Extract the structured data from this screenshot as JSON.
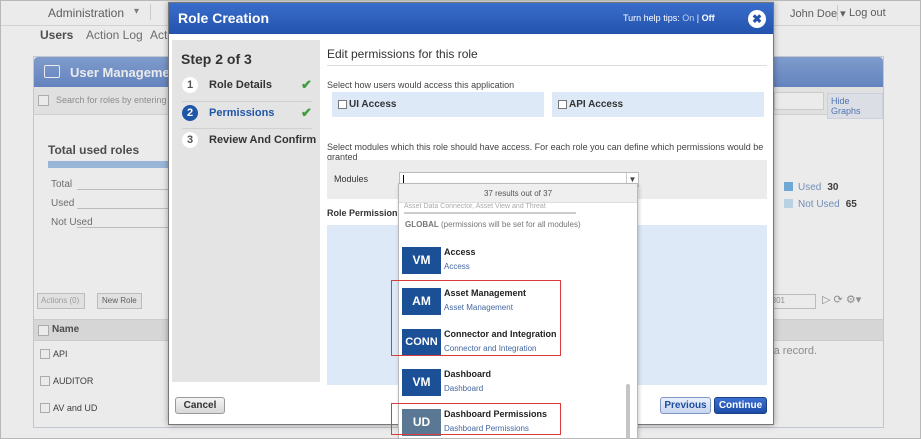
{
  "app": {
    "menu_label": "Administration",
    "user_name": "John Doe",
    "logout_label": "Log out",
    "tabs": [
      "Users",
      "Action Log",
      "Acti"
    ]
  },
  "panel": {
    "title": "User Management",
    "search_placeholder": "Search for roles by entering pro",
    "hide_graphs_label": "Hide Graphs",
    "total_title": "Total used roles",
    "stat_labels": [
      "Total",
      "Used",
      "Not Used"
    ],
    "legend": [
      {
        "label": "Used",
        "value": "30",
        "color": "#7ab7e8"
      },
      {
        "label": "Not Used",
        "value": "65",
        "color": "#c9e4f7"
      }
    ],
    "actions_label": "Actions (0)",
    "new_role_label": "New Role",
    "page_text": "801",
    "column_name": "Name",
    "rows": [
      "API",
      "AUDITOR",
      "AV and UD"
    ],
    "empty_text": "ct a record."
  },
  "modal": {
    "title": "Role Creation",
    "help_prefix": "Turn help tips:",
    "help_on": "On",
    "help_sep": "|",
    "help_off": "Off",
    "close_symbol": "✖",
    "step_title": "Step 2 of 3",
    "steps": [
      {
        "num": "1",
        "label": "Role Details",
        "done": true
      },
      {
        "num": "2",
        "label": "Permissions",
        "done": true
      },
      {
        "num": "3",
        "label": "Review And Confirm",
        "done": false
      }
    ],
    "check_mark": "✔",
    "heading": "Edit permissions for this role",
    "access_question": "Select how users would access this application",
    "ui_access_label": "UI Access",
    "api_access_label": "API Access",
    "modules_instruction": "Select modules which this role should have access. For each role you can define which permissions would be granted",
    "modules_label": "Modules",
    "role_permissions_label": "Role Permissions",
    "cancel_label": "Cancel",
    "previous_label": "Previous",
    "continue_label": "Continue"
  },
  "dropdown": {
    "results_text": "37 results out of 37",
    "cut_text": "Asset Data Connector, Asset View and Threat",
    "group_title": "GLOBAL",
    "group_note": "(permissions will be set for all modules)",
    "items": [
      {
        "badge": "VM",
        "name": "Access",
        "sub": "Access"
      },
      {
        "badge": "AM",
        "name": "Asset Management",
        "sub": "Asset Management"
      },
      {
        "badge": "CONN",
        "name": "Connector and Integration",
        "sub": "Connector and Integration"
      },
      {
        "badge": "VM",
        "name": "Dashboard",
        "sub": "Dashboard"
      },
      {
        "badge": "UD",
        "name": "Dashboard Permissions",
        "sub": "Dashboard Permissions"
      }
    ]
  },
  "colors": {
    "header_blue": "#2353ad",
    "badge_blue": "#1b4f96",
    "badge_gray": "#5a7893",
    "highlight_red": "#d93b3b",
    "check_green": "#3e9e3e"
  }
}
